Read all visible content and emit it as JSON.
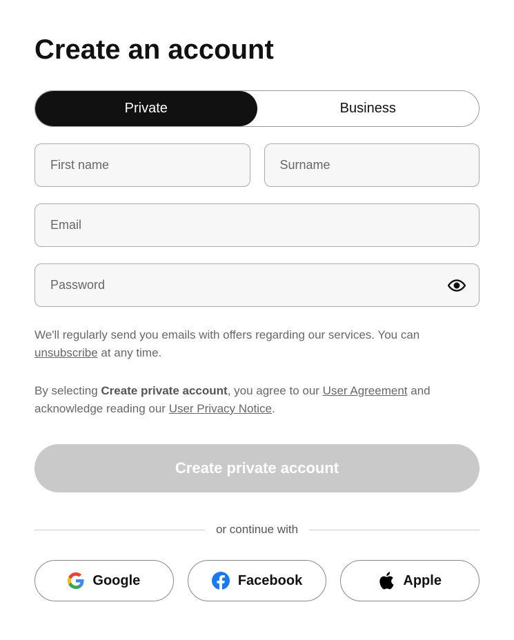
{
  "title": "Create an account",
  "tabs": {
    "private": "Private",
    "business": "Business"
  },
  "fields": {
    "first_name": {
      "placeholder": "First name",
      "value": ""
    },
    "surname": {
      "placeholder": "Surname",
      "value": ""
    },
    "email": {
      "placeholder": "Email",
      "value": ""
    },
    "password": {
      "placeholder": "Password",
      "value": ""
    }
  },
  "info": {
    "email_part1": "We'll regularly send you emails with offers regarding our services. You can ",
    "unsubscribe": "unsubscribe",
    "email_part2": " at any time.",
    "agree_part1": "By selecting ",
    "agree_bold": "Create private account",
    "agree_part2": ", you agree to our ",
    "user_agreement": "User Agreement",
    "agree_part3": " and acknowledge reading our ",
    "privacy_notice": "User Privacy Notice",
    "agree_part4": "."
  },
  "submit_label": "Create private account",
  "divider_text": "or continue with",
  "social": {
    "google": "Google",
    "facebook": "Facebook",
    "apple": "Apple"
  }
}
